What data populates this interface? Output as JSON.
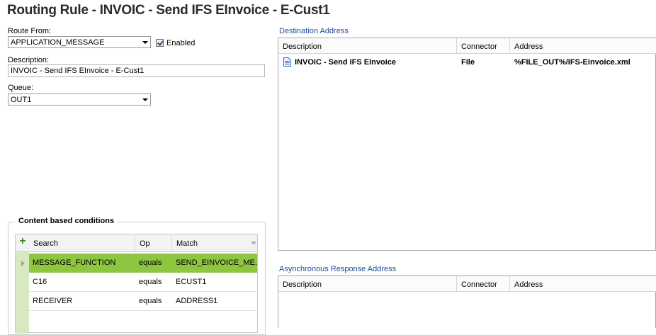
{
  "window": {
    "title": "Routing Rule - INVOIC - Send IFS EInvoice - E-Cust1"
  },
  "route_from": {
    "label": "Route From:",
    "value": "APPLICATION_MESSAGE"
  },
  "enabled": {
    "label": "Enabled",
    "checked": true
  },
  "description": {
    "label": "Description:",
    "value": "INVOIC - Send IFS EInvoice - E-Cust1"
  },
  "queue": {
    "label": "Queue:",
    "value": "OUT1"
  },
  "conditions": {
    "title": "Content based conditions",
    "add_icon": "plus-icon",
    "columns": [
      "Search",
      "Op",
      "Match"
    ],
    "rows": [
      {
        "search": "MESSAGE_FUNCTION",
        "op": "equals",
        "match": "SEND_EINVOICE_ME..."
      },
      {
        "search": "C16",
        "op": "equals",
        "match": "ECUST1"
      },
      {
        "search": "RECEIVER",
        "op": "equals",
        "match": "ADDRESS1"
      }
    ],
    "selected_row_color": "#8dc63f"
  },
  "destination": {
    "title": "Destination Address",
    "columns": [
      "Description",
      "Connector",
      "Address"
    ],
    "rows": [
      {
        "icon": "document-icon",
        "description": "INVOIC - Send IFS EInvoice",
        "connector": "File",
        "address": "%FILE_OUT%/IFS-Einvoice.xml"
      }
    ]
  },
  "async_response": {
    "title": "Asynchronous Response Address",
    "columns": [
      "Description",
      "Connector",
      "Address"
    ]
  }
}
